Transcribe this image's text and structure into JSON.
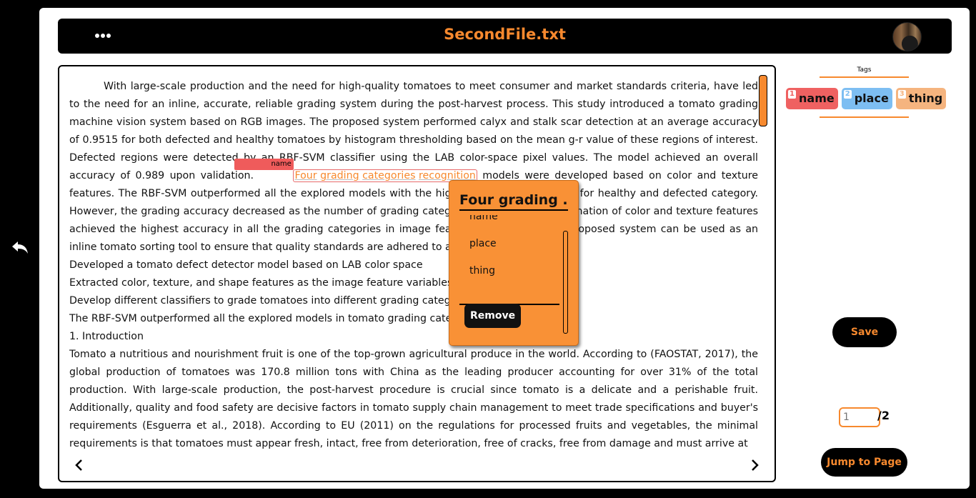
{
  "header": {
    "file_title": "SecondFile.txt",
    "menu_icon": "more-dots-icon",
    "avatar_icon": "user-avatar"
  },
  "nav": {
    "back_icon": "undo-arrow-icon",
    "prev_icon": "chevron-left-icon",
    "next_icon": "chevron-right-icon"
  },
  "document": {
    "p1_before": "With large-scale production and the need for high-quality tomatoes to meet consumer and market standards criteria, have led to the need for an inline, accurate, reliable grading system during the post-harvest process. This study introduced a tomato grading machine vision system based on RGB images. The proposed system performed calyx and stalk scar detection at an average accuracy of 0.9515 for both defected and healthy tomatoes by histogram thresholding based on the mean g-r value of these regions of interest. Defected regions were detected by an RBF-SVM classifier using the LAB color-space pixel values. The model achieved an overall accuracy of 0.989 upon validation.",
    "highlight": {
      "tag": "name",
      "words": [
        "Four",
        "grading",
        "categories",
        "recognition"
      ]
    },
    "p1_after": "models were developed based on color and texture features. The RBF-SVM outperformed all the explored models with the highest accuracy of 0.9709 for healthy and defected category. However, the grading accuracy decreased as the number of grading categories increased. A combination of color and texture features achieved the highest accuracy in all the grading categories in image features evaluation. This proposed system can be used as an inline tomato sorting tool to ensure that quality standards are adhered to and maintained.",
    "lines": [
      "Developed a tomato defect detector model based on LAB color space",
      "Extracted color, texture, and shape features as the image feature variables",
      "Develop different classifiers to grade tomatoes into different grading categories",
      "The RBF-SVM outperformed all the explored models in tomato grading categories",
      "1. Introduction"
    ],
    "p2": "Tomato a nutritious and nourishment fruit is one of the top-grown agricultural produce in the world. According to (FAOSTAT, 2017), the global production of tomatoes was 170.8 million tons with China as the leading producer accounting for over 31% of the total production. With large-scale production, the post-harvest procedure is crucial since tomato is a delicate and a perishable fruit. Additionally, quality and food safety are decisive factors in tomato supply chain management to meet trade specifications and buyer's requirements (Esguerra et al., 2018). According to EU (2011) on the regulations for processed fruits and vegetables, the minimal requirements is that tomatoes must appear fresh, intact, free from deterioration, free of cracks, free from damage and must arrive at"
  },
  "popup": {
    "title": "Four grading ...",
    "options": [
      "name",
      "place",
      "thing"
    ],
    "remove_label": "Remove"
  },
  "tags": {
    "title": "Tags",
    "items": [
      {
        "num": "1",
        "label": "name",
        "color": "#ef6161"
      },
      {
        "num": "2",
        "label": "place",
        "color": "#7dbef2"
      },
      {
        "num": "3",
        "label": "thing",
        "color": "#f5b47f"
      }
    ]
  },
  "actions": {
    "save_label": "Save",
    "jump_label": "Jump to Page"
  },
  "pagination": {
    "placeholder": "1",
    "total": "/2"
  },
  "colors": {
    "accent": "#f7892e",
    "background": "#000000"
  }
}
